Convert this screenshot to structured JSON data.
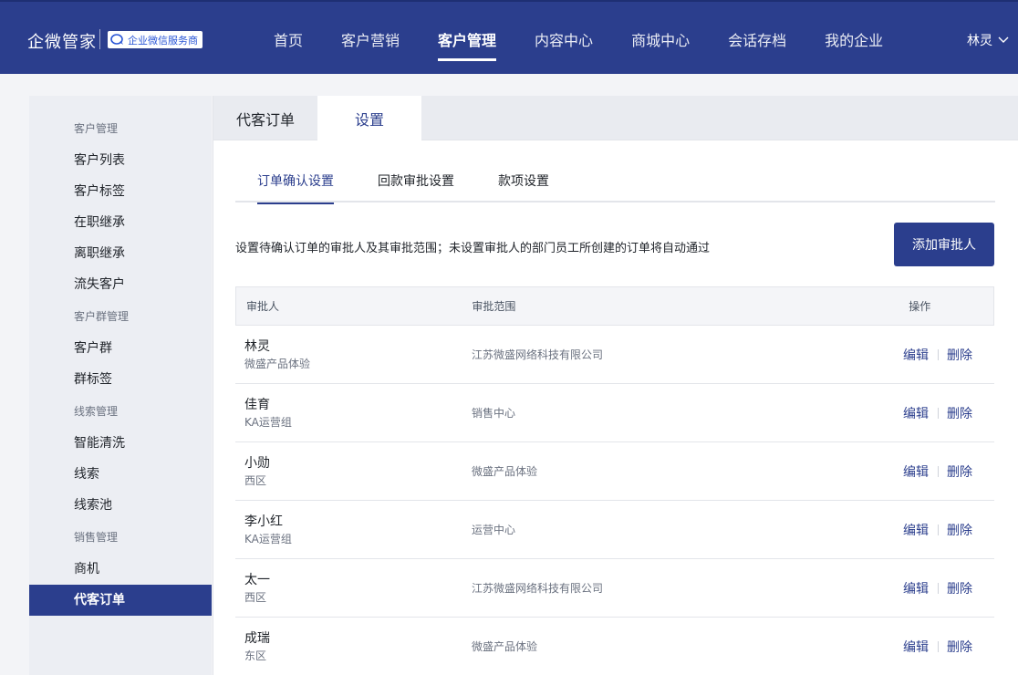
{
  "brand": {
    "name": "企微管家",
    "badge": "企业微信服务商"
  },
  "nav": {
    "items": [
      {
        "label": "首页",
        "active": false
      },
      {
        "label": "客户营销",
        "active": false
      },
      {
        "label": "客户管理",
        "active": true
      },
      {
        "label": "内容中心",
        "active": false
      },
      {
        "label": "商城中心",
        "active": false
      },
      {
        "label": "会话存档",
        "active": false
      },
      {
        "label": "我的企业",
        "active": false
      }
    ],
    "user": "林灵"
  },
  "sidebar": {
    "groups": [
      {
        "title": "客户管理",
        "items": [
          "客户列表",
          "客户标签",
          "在职继承",
          "离职继承",
          "流失客户"
        ]
      },
      {
        "title": "客户群管理",
        "items": [
          "客户群",
          "群标签"
        ]
      },
      {
        "title": "线索管理",
        "items": [
          "智能清洗",
          "线索",
          "线索池"
        ]
      },
      {
        "title": "销售管理",
        "items": [
          "商机",
          "代客订单"
        ]
      }
    ],
    "active_item": "代客订单"
  },
  "main": {
    "tabs": [
      {
        "label": "代客订单",
        "active": false
      },
      {
        "label": "设置",
        "active": true
      }
    ],
    "subtabs": [
      {
        "label": "订单确认设置",
        "active": true
      },
      {
        "label": "回款审批设置",
        "active": false
      },
      {
        "label": "款项设置",
        "active": false
      }
    ],
    "description": "设置待确认订单的审批人及其审批范围；未设置审批人的部门员工所创建的订单将自动通过",
    "add_button": "添加审批人",
    "table": {
      "columns": [
        "审批人",
        "审批范围",
        "操作"
      ],
      "edit_label": "编辑",
      "delete_label": "删除",
      "rows": [
        {
          "name": "林灵",
          "dept": "微盛产品体验",
          "scope": "江苏微盛网络科技有限公司"
        },
        {
          "name": "佳育",
          "dept": "KA运营组",
          "scope": "销售中心"
        },
        {
          "name": "小勋",
          "dept": "西区",
          "scope": "微盛产品体验"
        },
        {
          "name": "李小红",
          "dept": "KA运营组",
          "scope": "运营中心"
        },
        {
          "name": "太一",
          "dept": "西区",
          "scope": "江苏微盛网络科技有限公司"
        },
        {
          "name": "成瑞",
          "dept": "东区",
          "scope": "微盛产品体验"
        }
      ]
    }
  },
  "colors": {
    "primary": "#2b3e8d",
    "topbar": "#2b3e8d",
    "sidebar_bg": "#eceef3"
  }
}
